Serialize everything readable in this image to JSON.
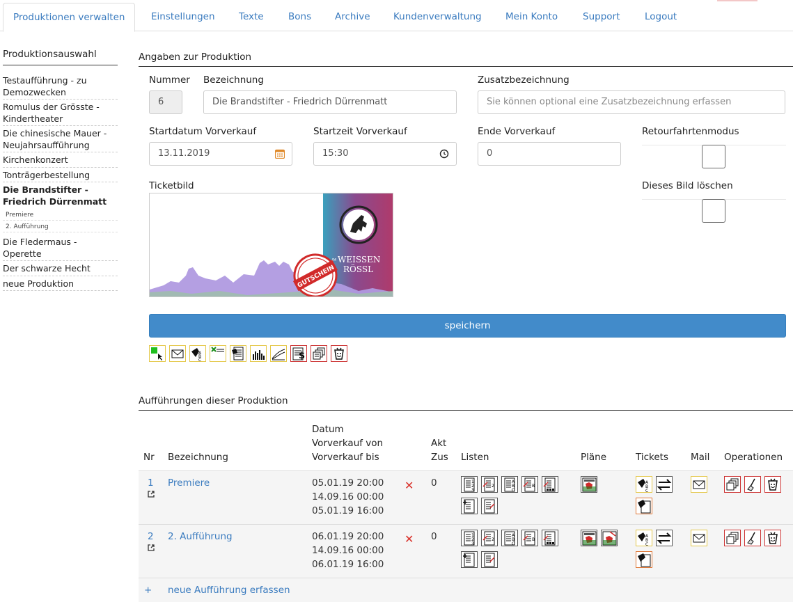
{
  "nav": {
    "tabs": [
      "Produktionen verwalten",
      "Einstellungen",
      "Texte",
      "Bons",
      "Archive",
      "Kundenverwaltung",
      "Mein Konto",
      "Support",
      "Logout"
    ],
    "active": "Produktionen verwalten"
  },
  "sidebar": {
    "title": "Produktionsauswahl",
    "items": [
      "Testaufführung - zu Demozwecken",
      "Romulus der Grösste - Kindertheater",
      "Die chinesische Mauer - Neujahrsaufführung",
      "Kirchenkonzert",
      "Tonträgerbestellung",
      "Die Brandstifter - Friedrich Dürrenmatt",
      "Die Fledermaus - Operette",
      "Der schwarze Hecht",
      "neue Produktion"
    ],
    "subitems": [
      "Premiere",
      "2. Aufführung"
    ]
  },
  "form": {
    "section_title": "Angaben zur Produktion",
    "nummer_label": "Nummer",
    "nummer_value": "6",
    "bezeichnung_label": "Bezeichnung",
    "bezeichnung_value": "Die Brandstifter - Friedrich Dürrenmatt",
    "zusatz_label": "Zusatzbezeichnung",
    "zusatz_placeholder": "Sie können optional eine Zusatzbezeichnung erfassen",
    "startdatum_label": "Startdatum Vorverkauf",
    "startdatum_value": "13.11.2019",
    "startzeit_label": "Startzeit Vorverkauf",
    "startzeit_value": "15:30",
    "ende_label": "Ende Vorverkauf",
    "ende_value": "0",
    "retour_label": "Retourfahrtenmodus",
    "ticketbild_label": "Ticketbild",
    "bild_loeschen_label": "Dieses Bild löschen",
    "save_label": "speichern"
  },
  "ticket_image": {
    "brand_small": "IM",
    "brand_line1": "WEISSEN",
    "brand_line2": "RÖSSL",
    "stamp": "GUTSCHEIN"
  },
  "toolbar": {
    "icons": [
      "select-icon",
      "mail-icon",
      "tickets-abc-icon",
      "list-icon",
      "print-icon",
      "stats-icon",
      "chart-icon",
      "dollar-icon",
      "copy-icon",
      "delete-icon"
    ]
  },
  "performances": {
    "section_title": "Aufführungen dieser Produktion",
    "headers": {
      "nr": "Nr",
      "bezeichnung": "Bezeichnung",
      "datum": "Datum",
      "vv_von": "Vorverkauf von",
      "vv_bis": "Vorverkauf bis",
      "akt": "Akt",
      "zus": "Zus",
      "listen": "Listen",
      "plaene": "Pläne",
      "tickets": "Tickets",
      "mail": "Mail",
      "operationen": "Operationen"
    },
    "rows": [
      {
        "nr": "1",
        "name": "Premiere",
        "datum": "05.01.19 20:00",
        "vv_von": "14.09.16 00:00",
        "vv_bis": "05.01.19 16:00",
        "akt_mark": "✕",
        "zus": "0"
      },
      {
        "nr": "2",
        "name": "2. Aufführung",
        "datum": "06.01.19 20:00",
        "vv_von": "14.09.16 00:00",
        "vv_bis": "06.01.19 16:00",
        "akt_mark": "✕",
        "zus": "0"
      }
    ],
    "add_symbol": "+",
    "add_label": "neue Aufführung erfassen"
  },
  "colors": {
    "link": "#3a7bbf",
    "primary_button": "#428bca",
    "error_mark": "#d9322b",
    "yellow_border": "#e4c84a",
    "red_border": "#cc3333"
  }
}
